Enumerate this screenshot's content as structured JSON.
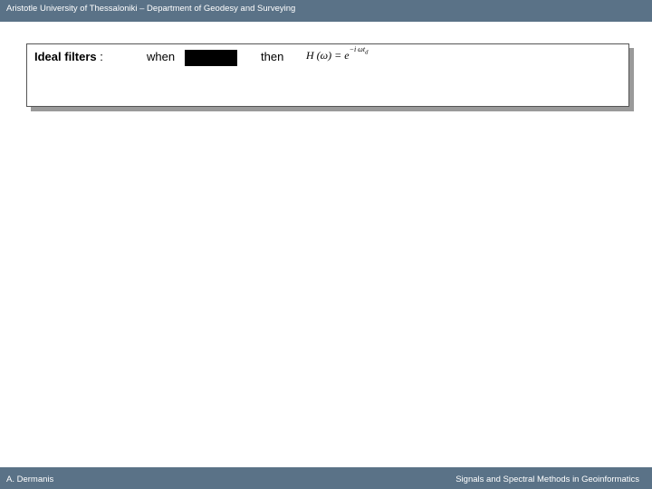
{
  "header": {
    "title": "Aristotle University of Thessaloniki – Department of Geodesy and Surveying"
  },
  "slide": {
    "ideal_label": "Ideal filters",
    "colon": " :",
    "when_label": "when",
    "then_label": "then",
    "formula_main": "H (ω) = e",
    "formula_exponent": "−i ωt",
    "formula_subscript": "d"
  },
  "footer": {
    "author": "A. Dermanis",
    "course": "Signals and Spectral Methods in Geoinformatics"
  }
}
